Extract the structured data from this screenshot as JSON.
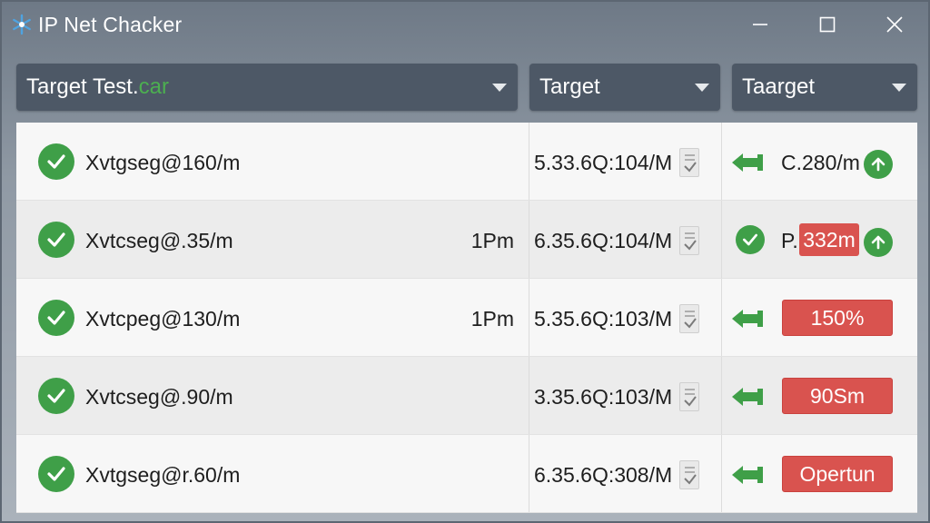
{
  "window": {
    "title": "IP Net Chacker",
    "icon": "snowflake-app-icon",
    "controls": [
      "minimize-icon",
      "maximize-icon",
      "close-icon"
    ]
  },
  "filters": {
    "col1": {
      "text": "Target Test.",
      "accent": "car"
    },
    "col2": {
      "text": "Target"
    },
    "col3": {
      "text": "Taarget"
    }
  },
  "rows": [
    {
      "host": "Xvtgseg@160/m",
      "time": "",
      "ip": "5.33.6Q:104/M",
      "indicator": "pin-icon",
      "status_text": "C.280/m",
      "status_up": true,
      "badge": ""
    },
    {
      "host": "Xvtcseg@.35/m",
      "time": "1Pm",
      "ip": "6.35.6Q:104/M",
      "indicator": "check-icon",
      "status_text": "P.",
      "status_up": true,
      "badge": "332m"
    },
    {
      "host": "Xvtcpeg@130/m",
      "time": "1Pm",
      "ip": "5.35.6Q:103/M",
      "indicator": "pin-icon",
      "status_text": "",
      "status_up": false,
      "badge": "150%"
    },
    {
      "host": "Xvtcseg@.90/m",
      "time": "",
      "ip": "3.35.6Q:103/M",
      "indicator": "pin-icon",
      "status_text": "",
      "status_up": false,
      "badge": "90Sm"
    },
    {
      "host": "Xvtgseg@r.60/m",
      "time": "",
      "ip": "6.35.6Q:308/M",
      "indicator": "pin-icon",
      "status_text": "",
      "status_up": false,
      "badge": "Opertun"
    }
  ],
  "colors": {
    "accent_green": "#3f9f48",
    "badge_red": "#d9534f",
    "header_bg": "#4d5866"
  }
}
